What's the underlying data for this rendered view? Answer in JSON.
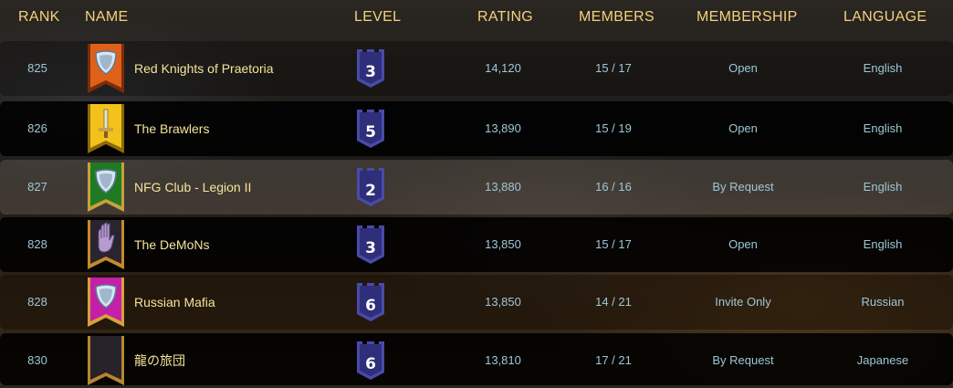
{
  "header": {
    "rank": "RANK",
    "name": "NAME",
    "level": "LEVEL",
    "rating": "RATING",
    "members": "MEMBERS",
    "membership": "MEMBERSHIP",
    "language": "LANGUAGE"
  },
  "rows": [
    {
      "rank": "825",
      "name": "Red Knights of Praetoria",
      "level": "3",
      "rating": "14,120",
      "members": "15 / 17",
      "membership": "Open",
      "language": "English",
      "emblem": "shield-icon",
      "banner_color": "#e0601a"
    },
    {
      "rank": "826",
      "name": "The Brawlers",
      "level": "5",
      "rating": "13,890",
      "members": "15 / 19",
      "membership": "Open",
      "language": "English",
      "emblem": "sword-icon",
      "banner_color": "#f2c21a"
    },
    {
      "rank": "827",
      "name": "NFG Club - Legion II",
      "level": "2",
      "rating": "13,880",
      "members": "16 / 16",
      "membership": "By Request",
      "language": "English",
      "emblem": "shield-icon",
      "banner_color": "#1f7a23"
    },
    {
      "rank": "828",
      "name": "The DeMoNs",
      "level": "3",
      "rating": "13,850",
      "members": "15 / 17",
      "membership": "Open",
      "language": "English",
      "emblem": "hand-icon",
      "banner_color": "#2a2430"
    },
    {
      "rank": "828",
      "name": "Russian Mafia",
      "level": "6",
      "rating": "13,850",
      "members": "14 / 21",
      "membership": "Invite Only",
      "language": "Russian",
      "emblem": "shield-icon",
      "banner_color": "#c41fa8"
    },
    {
      "rank": "830",
      "name": "龍の旅団",
      "level": "6",
      "rating": "13,810",
      "members": "17 / 21",
      "membership": "By Request",
      "language": "Japanese",
      "emblem": "none",
      "banner_color": "#26232a"
    }
  ],
  "colors": {
    "header_text": "#f3d27a",
    "name_text": "#f5e39a",
    "cell_text": "#9fc6d6",
    "level_badge": "#3d3d8f"
  }
}
